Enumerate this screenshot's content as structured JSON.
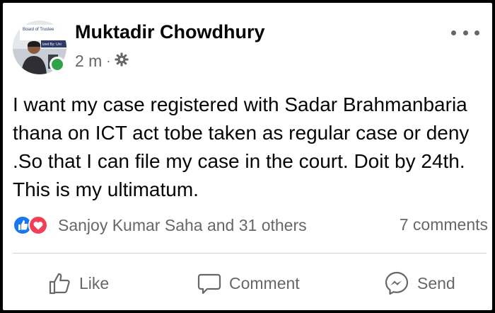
{
  "post": {
    "author": "Muktadir Chowdhury",
    "time": "2 m",
    "separator": "·",
    "privacy_icon": "gear-icon",
    "text": "I want my case registered with Sadar Brahmanbaria thana on ICT act tobe taken as regular case or deny .So that I can file my case in the court. Doit by 24th. This is my ultimatum.",
    "avatar_banner_line1": "Board of Trustee",
    "avatar_banner_line2": "ized By: Uni"
  },
  "reactions": {
    "icons": [
      "like-reaction-icon",
      "love-reaction-icon"
    ],
    "summary": "Sanjoy Kumar Saha and 31 others",
    "comments": "7 comments"
  },
  "actions": {
    "like": "Like",
    "comment": "Comment",
    "send": "Send"
  },
  "colors": {
    "text": "#050505",
    "secondary": "#65676b",
    "like_blue": "#1877f2",
    "love_red": "#f33e58",
    "online_green": "#31a24c",
    "divider": "#ced0d4"
  }
}
